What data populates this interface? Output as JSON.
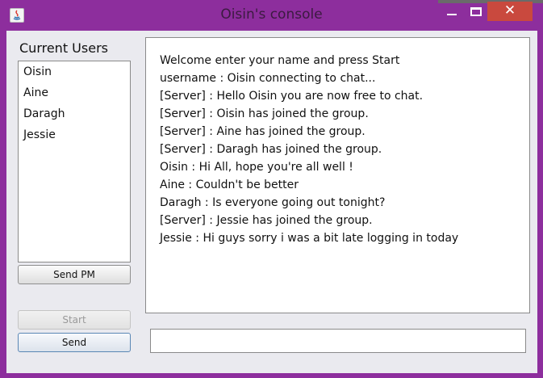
{
  "window": {
    "title": "Oisin's console",
    "close_glyph": "✕",
    "colors": {
      "frame": "#8d2e9d",
      "close_button": "#c9493e",
      "client": "#eaeaef"
    }
  },
  "icons": {
    "app": "java-icon",
    "minimize": "minimize-icon",
    "maximize": "maximize-icon",
    "close": "close-icon"
  },
  "users_panel": {
    "title": "Current Users",
    "users": [
      "Oisin",
      "Aine",
      "Daragh",
      "Jessie"
    ]
  },
  "buttons": {
    "send_pm": "Send PM",
    "start": "Start",
    "send": "Send"
  },
  "chat": {
    "lines": [
      "Welcome enter your name and press Start",
      "username : Oisin connecting to chat...",
      "[Server] : Hello Oisin you are now free to chat.",
      "[Server] : Oisin has joined the group.",
      "[Server] : Aine has joined the group.",
      "[Server] : Daragh has joined the group.",
      "Oisin : Hi All, hope you're all well !",
      "Aine : Couldn't be better",
      "Daragh : Is everyone going out tonight?",
      "[Server] : Jessie has joined the group.",
      "Jessie : Hi guys sorry i was a bit late logging in today"
    ]
  },
  "message_input": {
    "value": "",
    "placeholder": ""
  }
}
